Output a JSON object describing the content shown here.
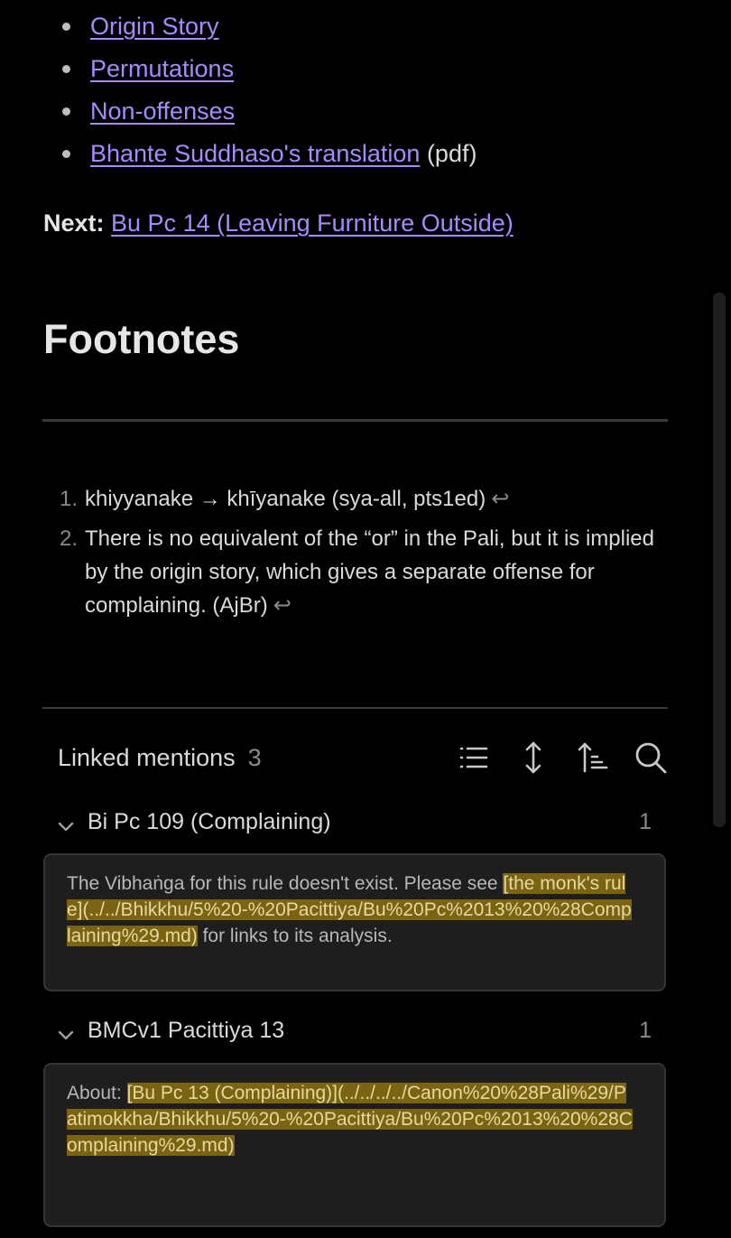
{
  "links": [
    {
      "label": "Origin Story",
      "suffix": ""
    },
    {
      "label": "Permutations",
      "suffix": ""
    },
    {
      "label": "Non-offenses",
      "suffix": ""
    },
    {
      "label": "Bhante Suddhaso's translation",
      "suffix": "(pdf)"
    }
  ],
  "next": {
    "label": "Next:",
    "link": "Bu Pc 14 (Leaving Furniture Outside)"
  },
  "footnotes": {
    "heading": "Footnotes",
    "items": [
      {
        "num": "1.",
        "text": "khiyyanake → khīyanake (sya-all, pts1ed)",
        "back": "↩"
      },
      {
        "num": "2.",
        "text": "There is no equivalent of the “or” in the Pali, but it is implied by the origin story, which gives a separate offense for complaining. (AjBr)",
        "back": "↩"
      }
    ]
  },
  "linked_mentions": {
    "title": "Linked mentions",
    "count": "3",
    "tools": [
      "list-icon",
      "expand-vertical-icon",
      "sort-icon",
      "search-icon"
    ],
    "groups": [
      {
        "title": "Bi Pc 109 (Complaining)",
        "count": "1",
        "card": {
          "before": "The Vibhaṅga for this rule doesn't exist. Please see ",
          "highlight": "[the monk's rule](../../Bhikkhu/5%20-%20Pacittiya/Bu%20Pc%2013%20%28Complaining%29.md)",
          "after": " for links to its analysis."
        }
      },
      {
        "title": "BMCv1 Pacittiya 13",
        "count": "1",
        "card": {
          "before": "About: ",
          "highlight": "[Bu Pc 13 (Complaining)](../../../../Canon%20%28Pali%29/Patimokkha/Bhikkhu/5%20-%20Pacittiya/Bu%20Pc%2013%20%28Complaining%29.md)",
          "after": ""
        }
      }
    ]
  },
  "colors": {
    "background": "#000000",
    "link": "#a88bfa",
    "highlight": "#7a6412",
    "card": "#1e1e1e"
  }
}
